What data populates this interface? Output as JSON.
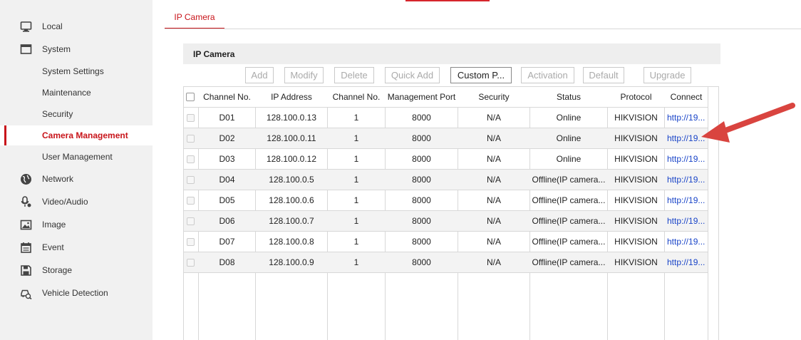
{
  "sidebar": {
    "items": [
      {
        "label": "Local",
        "icon": "monitor-icon",
        "level": 1
      },
      {
        "label": "System",
        "icon": "system-window-icon",
        "level": 1
      },
      {
        "label": "System Settings",
        "level": 2
      },
      {
        "label": "Maintenance",
        "level": 2
      },
      {
        "label": "Security",
        "level": 2
      },
      {
        "label": "Camera Management",
        "level": 2,
        "active": true
      },
      {
        "label": "User Management",
        "level": 2
      },
      {
        "label": "Network",
        "icon": "globe-icon",
        "level": 1
      },
      {
        "label": "Video/Audio",
        "icon": "microphone-icon",
        "level": 1
      },
      {
        "label": "Image",
        "icon": "image-icon",
        "level": 1
      },
      {
        "label": "Event",
        "icon": "calendar-icon",
        "level": 1
      },
      {
        "label": "Storage",
        "icon": "save-disk-icon",
        "level": 1
      },
      {
        "label": "Vehicle Detection",
        "icon": "vehicle-search-icon",
        "level": 1
      }
    ]
  },
  "tabs": [
    {
      "label": "IP Camera",
      "active": true
    }
  ],
  "panel": {
    "title": "IP Camera"
  },
  "toolbar": {
    "buttons": [
      {
        "label": "Add",
        "enabled": false
      },
      {
        "label": "Modify",
        "enabled": false
      },
      {
        "label": "Delete",
        "enabled": false
      },
      {
        "label": "Quick Add",
        "enabled": false
      },
      {
        "label": "Custom P...",
        "enabled": true
      },
      {
        "label": "Activation",
        "enabled": false
      },
      {
        "label": "Default",
        "enabled": false
      },
      {
        "label": "Upgrade",
        "enabled": false
      }
    ]
  },
  "table": {
    "columns": [
      "Channel No.",
      "IP Address",
      "Channel No.",
      "Management Port",
      "Security",
      "Status",
      "Protocol",
      "Connect"
    ],
    "rows": [
      [
        "D01",
        "128.100.0.13",
        "1",
        "8000",
        "N/A",
        "Online",
        "HIKVISION",
        "http://19..."
      ],
      [
        "D02",
        "128.100.0.11",
        "1",
        "8000",
        "N/A",
        "Online",
        "HIKVISION",
        "http://19..."
      ],
      [
        "D03",
        "128.100.0.12",
        "1",
        "8000",
        "N/A",
        "Online",
        "HIKVISION",
        "http://19..."
      ],
      [
        "D04",
        "128.100.0.5",
        "1",
        "8000",
        "N/A",
        "Offline(IP camera...",
        "HIKVISION",
        "http://19..."
      ],
      [
        "D05",
        "128.100.0.6",
        "1",
        "8000",
        "N/A",
        "Offline(IP camera...",
        "HIKVISION",
        "http://19..."
      ],
      [
        "D06",
        "128.100.0.7",
        "1",
        "8000",
        "N/A",
        "Offline(IP camera...",
        "HIKVISION",
        "http://19..."
      ],
      [
        "D07",
        "128.100.0.8",
        "1",
        "8000",
        "N/A",
        "Offline(IP camera...",
        "HIKVISION",
        "http://19..."
      ],
      [
        "D08",
        "128.100.0.9",
        "1",
        "8000",
        "N/A",
        "Offline(IP camera...",
        "HIKVISION",
        "http://19..."
      ]
    ]
  },
  "colors": {
    "accent": "#c8141a",
    "link": "#1a45c8",
    "annotation_arrow": "#d9443f"
  }
}
